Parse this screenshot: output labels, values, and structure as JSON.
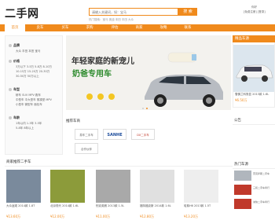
{
  "header": {
    "logo": "二手网",
    "search_placeholder": "请输入关键词，如：宝马",
    "search_button": "搜 索",
    "hot_links": "热门搜索：宝马 奥迪 本田 丰田 大众",
    "top_right_1": "你好",
    "top_right_2": "[免费注册] [登录]"
  },
  "nav": [
    {
      "label": "首页",
      "active": true
    },
    {
      "label": "卖车"
    },
    {
      "label": "买车"
    },
    {
      "label": "求购"
    },
    {
      "label": "评估"
    },
    {
      "label": "商家"
    },
    {
      "label": "攻略"
    },
    {
      "label": "联系"
    }
  ],
  "filter": {
    "sections": [
      {
        "title": "品牌",
        "lines": [
          "大众 丰田 本田 宝马"
        ]
      },
      {
        "title": "价格",
        "lines": [
          "3万以下  3-5万  5-8万  8-10万",
          "10-15万  15-20万  20-30万",
          "30-50万  50万以上"
        ]
      },
      {
        "title": "车型",
        "lines": [
          "轿车  SUV  MPV  跑车",
          "中型车  中大型车  紧凑型  MPV",
          "小型车  微型车  面包车"
        ]
      },
      {
        "title": "车龄",
        "lines": [
          "1年以内  1-3年  3-5年",
          "5-8年  8年以上"
        ]
      }
    ]
  },
  "banner": {
    "line1": "年轻家庭的新宠儿",
    "line2": "奶爸专用车"
  },
  "right_column": {
    "featured_title": "精品车源",
    "featured_caption": "雪佛兰科鲁兹 2013款 1.6L",
    "featured_price": "¥6.50万",
    "notice_title": "公告",
    "hot_title": "热门车源",
    "hot_items": [
      {
        "text": "雷克萨斯二手车"
      },
      {
        "text": "三和二手车商行"
      },
      {
        "text": "诚信二手车商行"
      }
    ]
  },
  "merchant_section": {
    "title": "推荐车商",
    "merchants": [
      "易车二手车",
      "SANHE",
      "DX二手车",
      "合作伙伴"
    ]
  },
  "recommended": {
    "title": "商家推荐二手车",
    "items": [
      {
        "caption": "大众途观 2014款 1.8T",
        "price": "¥13.60万",
        "color": "#7a8a9c"
      },
      {
        "caption": "北京现代 2014款 1.6L",
        "price": "¥12.00万",
        "color": "#8c9b3a"
      },
      {
        "caption": "别克英朗 2013款 1.5L",
        "price": "¥11.00万",
        "color": "#a9a9a9"
      },
      {
        "caption": "福特福克斯 2014款 1.6L",
        "price": "¥12.80万",
        "color": "#e0e0e0"
      },
      {
        "caption": "哈弗H6 2013款 1.5T",
        "price": "¥13.20万",
        "color": "#eeeeee"
      }
    ]
  }
}
